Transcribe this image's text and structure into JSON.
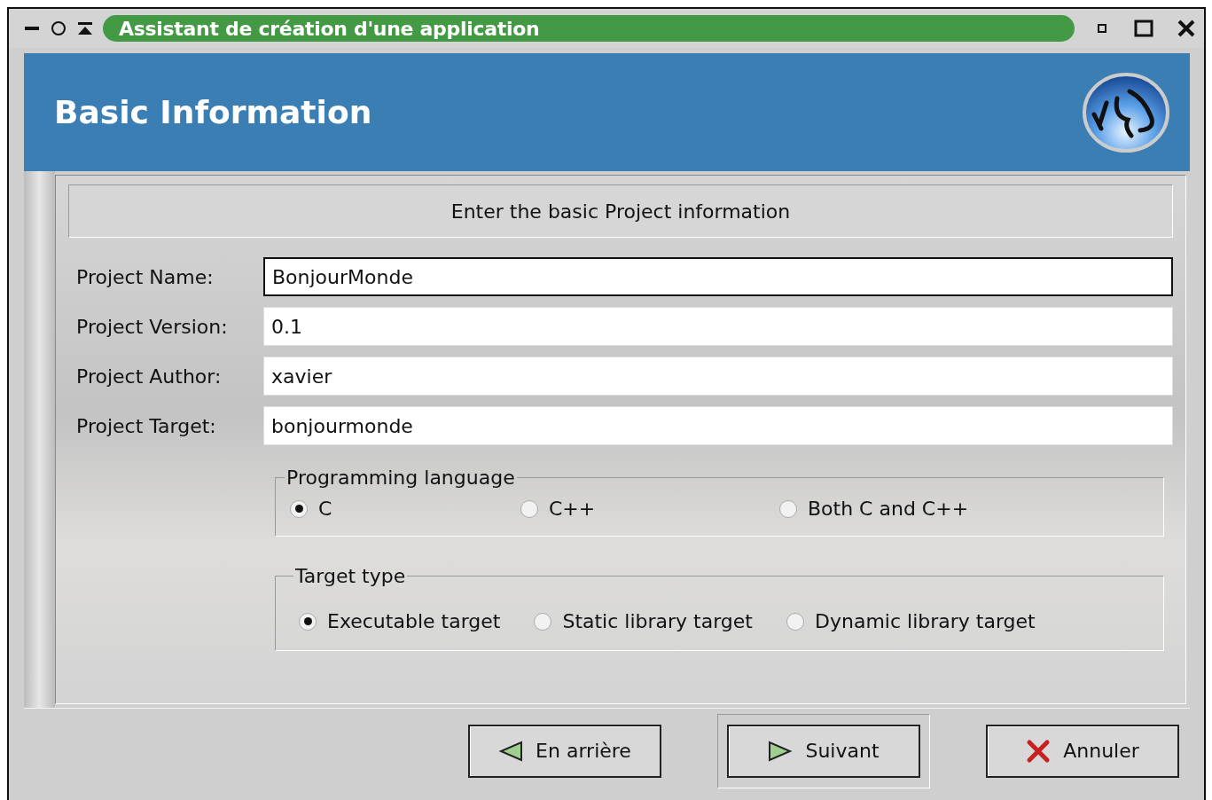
{
  "window": {
    "title": "Assistant de création d'une application"
  },
  "header": {
    "title": "Basic Information"
  },
  "intro": "Enter the basic Project information",
  "fields": [
    {
      "label": "Project Name:",
      "value": "BonjourMonde",
      "focused": true
    },
    {
      "label": "Project Version:",
      "value": "0.1",
      "focused": false
    },
    {
      "label": "Project Author:",
      "value": "xavier",
      "focused": false
    },
    {
      "label": "Project Target:",
      "value": "bonjourmonde",
      "focused": false
    }
  ],
  "groups": [
    {
      "title": "Programming language",
      "kind": "grid",
      "options": [
        {
          "label": "C",
          "selected": true
        },
        {
          "label": "C++",
          "selected": false
        },
        {
          "label": "Both C and C++",
          "selected": false
        }
      ]
    },
    {
      "title": "Target type",
      "kind": "row",
      "options": [
        {
          "label": "Executable target",
          "selected": true
        },
        {
          "label": "Static library target",
          "selected": false
        },
        {
          "label": "Dynamic library target",
          "selected": false
        }
      ]
    }
  ],
  "buttons": [
    {
      "label": "En arrière",
      "kind": "back",
      "default": false
    },
    {
      "label": "Suivant",
      "kind": "next",
      "default": true
    },
    {
      "label": "Annuler",
      "kind": "cancel",
      "default": false
    }
  ]
}
